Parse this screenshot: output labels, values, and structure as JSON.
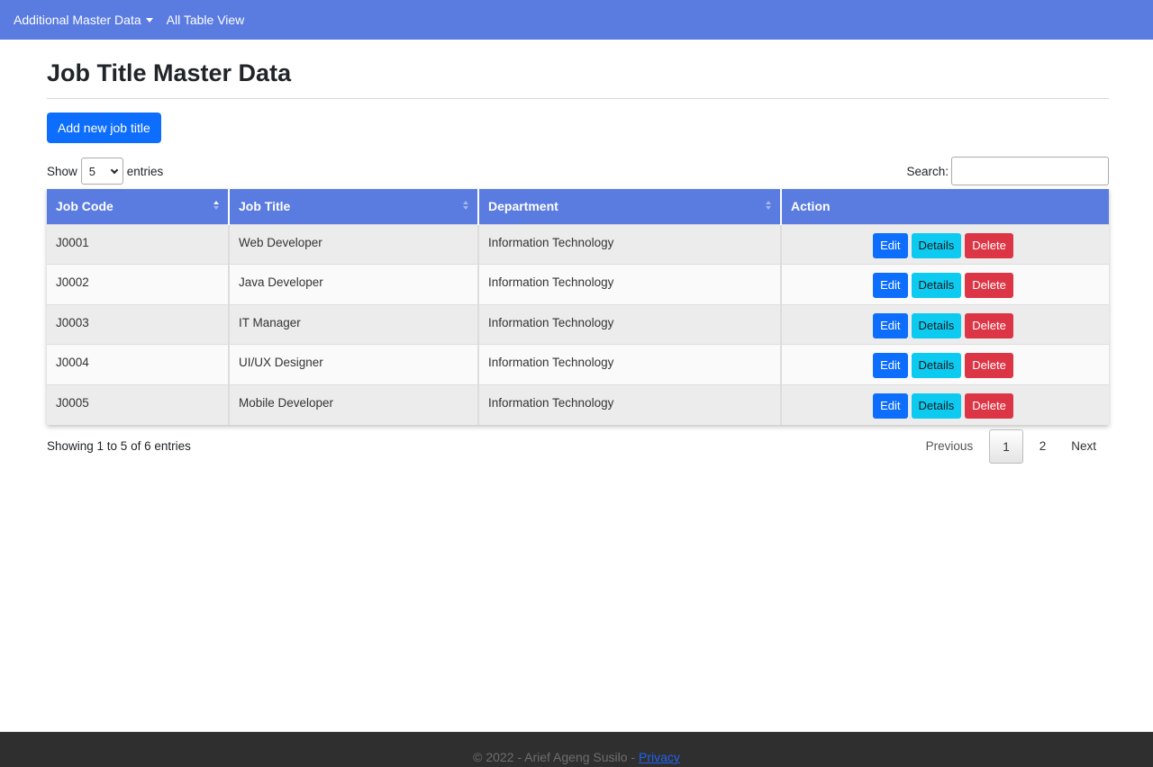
{
  "navbar": {
    "items": [
      {
        "label": "Additional Master Data",
        "dropdown": true
      },
      {
        "label": "All Table View"
      }
    ]
  },
  "page": {
    "title": "Job Title Master Data",
    "add_button": "Add new job title"
  },
  "datatable": {
    "show_label": "Show",
    "entries_label": "entries",
    "page_length": "5",
    "search_label": "Search:",
    "search_value": "",
    "columns": [
      "Job Code",
      "Job Title",
      "Department",
      "Action"
    ],
    "rows": [
      {
        "code": "J0001",
        "title": "Web Developer",
        "department": "Information Technology"
      },
      {
        "code": "J0002",
        "title": "Java Developer",
        "department": "Information Technology"
      },
      {
        "code": "J0003",
        "title": "IT Manager",
        "department": "Information Technology"
      },
      {
        "code": "J0004",
        "title": "UI/UX Designer",
        "department": "Information Technology"
      },
      {
        "code": "J0005",
        "title": "Mobile Developer",
        "department": "Information Technology"
      }
    ],
    "actions": {
      "edit": "Edit",
      "details": "Details",
      "delete": "Delete"
    },
    "info": "Showing 1 to 5 of 6 entries",
    "pagination": {
      "previous": "Previous",
      "pages": [
        "1",
        "2"
      ],
      "current": "1",
      "next": "Next"
    }
  },
  "footer": {
    "text": "© 2022 - Arief Ageng Susilo - ",
    "link": "Privacy"
  },
  "colors": {
    "navbar": "#5a7be0",
    "primary": "#0d6efd",
    "info": "#0dcaf0",
    "danger": "#dc3545",
    "footer": "#2f2f2f"
  }
}
